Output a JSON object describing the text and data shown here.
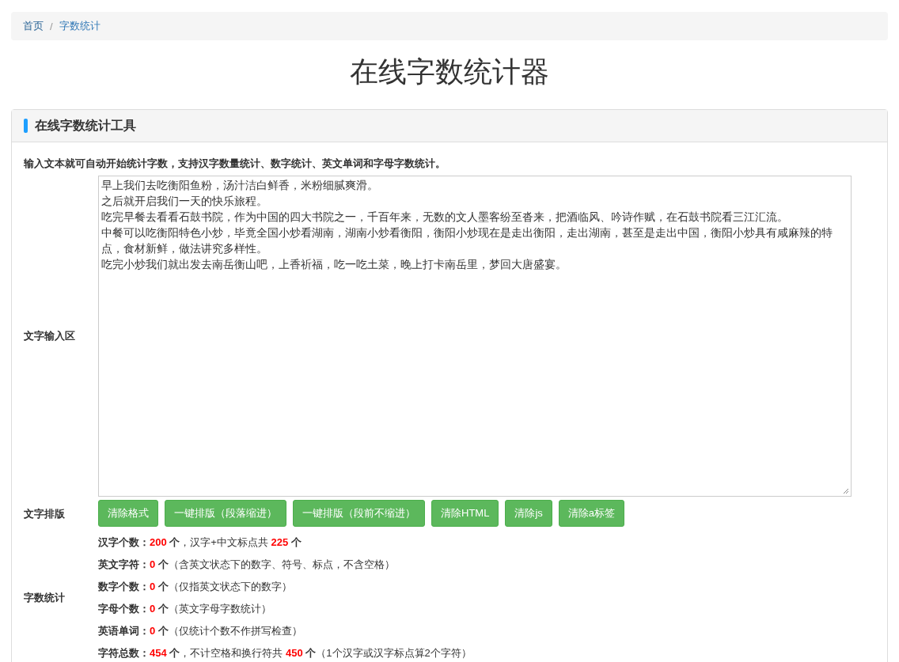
{
  "breadcrumb": [
    {
      "label": "首页",
      "selected": false
    },
    {
      "label": "字数统计",
      "selected": true
    }
  ],
  "breadcrumb_separator": "/",
  "title": "在线字数统计器",
  "panel": {
    "title": "在线字数统计工具",
    "description": "输入文本就可自动开始统计字数，支持汉字数量统计、数字统计、英文单词和字母字数统计。",
    "input_label": "文字输入区",
    "input_lines": [
      "早上我们去吃衡阳鱼粉，汤汁洁白鲜香，米粉细腻爽滑。",
      "之后就开启我们一天的快乐旅程。",
      "吃完早餐去看看石鼓书院，作为中国的四大书院之一，千百年来，无数的文人墨客纷至沓来，把酒临风、吟诗作赋，在石鼓书院看三江汇流。",
      "中餐可以吃衡阳特色小炒，毕竟全国小炒看湖南，湖南小炒看衡阳，衡阳小炒现在是走出衡阳，走出湖南，甚至是走出中国，衡阳小炒具有咸麻辣的特点，食材新鲜，做法讲究多样性。",
      "吃完小炒我们就出发去南岳衡山吧，上香祈福，吃一吃土菜，晚上打卡南岳里，梦回大唐盛宴。"
    ],
    "format_label": "文字排版",
    "buttons": [
      "清除格式",
      "一键排版（段落缩进）",
      "一键排版（段前不缩进）",
      "清除HTML",
      "清除js",
      "清除a标签"
    ],
    "stats_label": "字数统计",
    "stats": [
      [
        {
          "kind": "label",
          "text": "汉字个数："
        },
        {
          "kind": "value",
          "text": "200"
        },
        {
          "kind": "label",
          "text": " 个"
        },
        {
          "kind": "text",
          "text": "，汉字+中文标点共 "
        },
        {
          "kind": "value",
          "text": "225"
        },
        {
          "kind": "label",
          "text": " 个"
        }
      ],
      [
        {
          "kind": "label",
          "text": "英文字符："
        },
        {
          "kind": "value",
          "text": "0"
        },
        {
          "kind": "label",
          "text": " 个"
        },
        {
          "kind": "text",
          "text": "（含英文状态下的数字、符号、标点，不含空格）"
        }
      ],
      [
        {
          "kind": "label",
          "text": "数字个数："
        },
        {
          "kind": "value",
          "text": "0"
        },
        {
          "kind": "label",
          "text": " 个"
        },
        {
          "kind": "text",
          "text": "（仅指英文状态下的数字）"
        }
      ],
      [
        {
          "kind": "label",
          "text": "字母个数："
        },
        {
          "kind": "value",
          "text": "0"
        },
        {
          "kind": "label",
          "text": " 个"
        },
        {
          "kind": "text",
          "text": "（英文字母字数统计）"
        }
      ],
      [
        {
          "kind": "label",
          "text": "英语单词："
        },
        {
          "kind": "value",
          "text": "0"
        },
        {
          "kind": "label",
          "text": " 个"
        },
        {
          "kind": "text",
          "text": "（仅统计个数不作拼写检查）"
        }
      ],
      [
        {
          "kind": "label",
          "text": "字符总数："
        },
        {
          "kind": "value",
          "text": "454"
        },
        {
          "kind": "label",
          "text": " 个"
        },
        {
          "kind": "text",
          "text": "，不计空格和换行符共 "
        },
        {
          "kind": "value",
          "text": "450"
        },
        {
          "kind": "label",
          "text": " 个"
        },
        {
          "kind": "text",
          "text": "（1个汉字或汉字标点算2个字符）"
        }
      ]
    ]
  }
}
